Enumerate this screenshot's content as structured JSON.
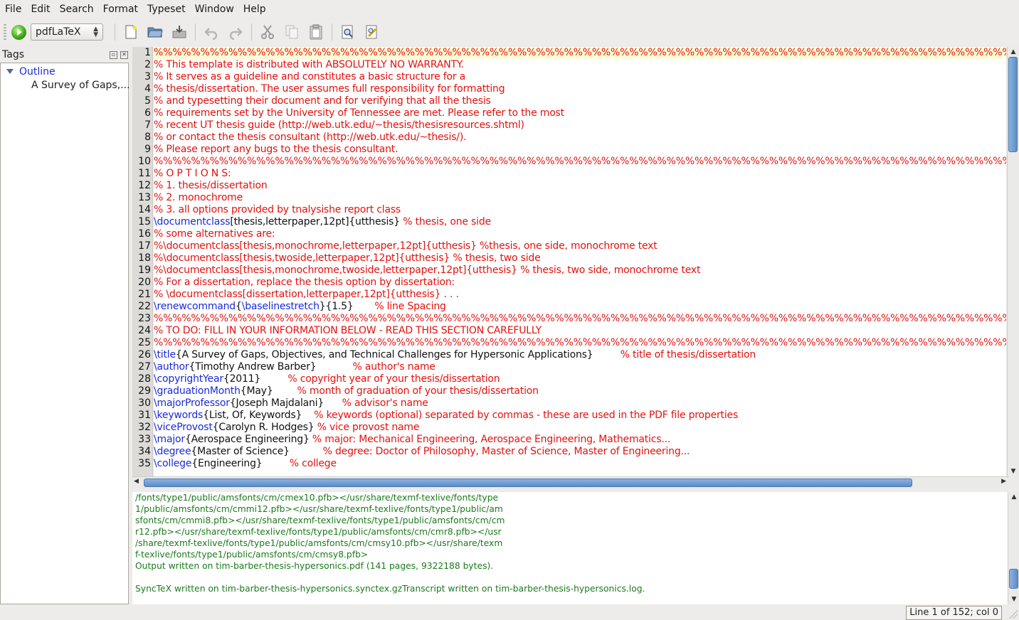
{
  "menu": [
    "File",
    "Edit",
    "Search",
    "Format",
    "Typeset",
    "Window",
    "Help"
  ],
  "toolbar": {
    "engine": "pdfLaTeX",
    "icons": [
      "run-icon",
      "new-file-icon",
      "open-file-icon",
      "save-icon",
      "undo-icon",
      "redo-icon",
      "cut-icon",
      "copy-icon",
      "paste-icon",
      "find-icon",
      "replace-icon"
    ]
  },
  "sidebar": {
    "title": "Tags",
    "outline_label": "Outline",
    "outline_items": [
      "A Survey of Gaps,..."
    ]
  },
  "editor": {
    "lines": [
      {
        "n": "1",
        "parts": [
          {
            "t": "c",
            "s": "%%%%%%%%%%%%%%%%%%%%%%%%%%%%%%%%%%%%%%%%%%%%%%%%%%%%%%%%%%%%%%%%%%%%%%%%%%%%%%%%%%%%%%%%%%%%%%%%%%%%%%%%%%%%%%%%%%%%%%%%%%%%%%%%%%%%%%%%%%%%%%%%%%%%%%%%%%%%%%%%%%%%%%%%%%%%"
          }
        ]
      },
      {
        "n": "2",
        "parts": [
          {
            "t": "c",
            "s": "% This template is distributed with ABSOLUTELY NO WARRANTY."
          }
        ]
      },
      {
        "n": "3",
        "parts": [
          {
            "t": "c",
            "s": "% It serves as a guideline and constitutes a basic structure for a"
          }
        ]
      },
      {
        "n": "4",
        "parts": [
          {
            "t": "c",
            "s": "% thesis/dissertation. The user assumes full responsibility for formatting"
          }
        ]
      },
      {
        "n": "5",
        "parts": [
          {
            "t": "c",
            "s": "% and typesetting their document and for verifying that all the thesis"
          }
        ]
      },
      {
        "n": "6",
        "parts": [
          {
            "t": "c",
            "s": "% requirements set by the University of Tennessee are met. Please refer to the most"
          }
        ]
      },
      {
        "n": "7",
        "parts": [
          {
            "t": "c",
            "s": "% recent UT thesis guide (http://web.utk.edu/~thesis/thesisresources.shtml)"
          }
        ]
      },
      {
        "n": "8",
        "parts": [
          {
            "t": "c",
            "s": "% or contact the thesis consultant (http://web.utk.edu/~thesis/)."
          }
        ]
      },
      {
        "n": "9",
        "parts": [
          {
            "t": "c",
            "s": "% Please report any bugs to the thesis consultant."
          }
        ]
      },
      {
        "n": "10",
        "parts": [
          {
            "t": "c",
            "s": "%%%%%%%%%%%%%%%%%%%%%%%%%%%%%%%%%%%%%%%%%%%%%%%%%%%%%%%%%%%%%%%%%%%%%%%%%%%%%%%%%%%%%%%%%%%%%%%%%%%%%%%%%%%%%%%%%%%%%%%%%%%%%%%%%%%%%%%%%%%%%%%%%%%%%%%%%%%%%%%%%%%%%%%%%%%%"
          }
        ]
      },
      {
        "n": "11",
        "parts": [
          {
            "t": "c",
            "s": "% O P T I O N S:"
          }
        ]
      },
      {
        "n": "12",
        "parts": [
          {
            "t": "c",
            "s": "% 1. thesis/dissertation"
          }
        ]
      },
      {
        "n": "13",
        "parts": [
          {
            "t": "c",
            "s": "% 2. monochrome"
          }
        ]
      },
      {
        "n": "14",
        "parts": [
          {
            "t": "c",
            "s": "% 3. all options provided by tnalysishe report class"
          }
        ]
      },
      {
        "n": "15",
        "parts": [
          {
            "t": "k",
            "s": "\\documentclass"
          },
          {
            "t": "p",
            "s": "[thesis,letterpaper,12pt]{utthesis} "
          },
          {
            "t": "c",
            "s": "% thesis, one side"
          }
        ]
      },
      {
        "n": "16",
        "parts": [
          {
            "t": "c",
            "s": "% some alternatives are:"
          }
        ]
      },
      {
        "n": "17",
        "parts": [
          {
            "t": "c",
            "s": "%\\documentclass[thesis,monochrome,letterpaper,12pt]{utthesis} %thesis, one side, monochrome text"
          }
        ]
      },
      {
        "n": "18",
        "parts": [
          {
            "t": "c",
            "s": "%\\documentclass[thesis,twoside,letterpaper,12pt]{utthesis} % thesis, two side"
          }
        ]
      },
      {
        "n": "19",
        "parts": [
          {
            "t": "c",
            "s": "%\\documentclass[thesis,monochrome,twoside,letterpaper,12pt]{utthesis} % thesis, two side, monochrome text"
          }
        ]
      },
      {
        "n": "20",
        "parts": [
          {
            "t": "c",
            "s": "% For a dissertation, replace the thesis option by dissertation:"
          }
        ]
      },
      {
        "n": "21",
        "parts": [
          {
            "t": "c",
            "s": "% \\documentclass[dissertation,letterpaper,12pt]{utthesis} . . ."
          }
        ]
      },
      {
        "n": "22",
        "parts": [
          {
            "t": "k",
            "s": "\\renewcommand"
          },
          {
            "t": "p",
            "s": "{"
          },
          {
            "t": "k",
            "s": "\\baselinestretch"
          },
          {
            "t": "p",
            "s": "}{1.5}       "
          },
          {
            "t": "c",
            "s": "% line Spacing"
          }
        ]
      },
      {
        "n": "23",
        "parts": [
          {
            "t": "c",
            "s": "%%%%%%%%%%%%%%%%%%%%%%%%%%%%%%%%%%%%%%%%%%%%%%%%%%%%%%%%%%%%%%%%%%%%%%%%%%%%%%%%%%%%%%%%%%%%%%%%%%%%%%%%%%%%%%%%%%%%%%%%%%%%%%%%%%%%%%%%%%%%%%%%%%%%%%%%%%%%%%%%%%%%%%%%%%%%"
          }
        ]
      },
      {
        "n": "24",
        "parts": [
          {
            "t": "c",
            "s": "% TO DO: FILL IN YOUR INFORMATION BELOW - READ THIS SECTION CAREFULLY"
          }
        ]
      },
      {
        "n": "25",
        "parts": [
          {
            "t": "c",
            "s": "%%%%%%%%%%%%%%%%%%%%%%%%%%%%%%%%%%%%%%%%%%%%%%%%%%%%%%%%%%%%%%%%%%%%%%%%%%%%%%%%%%%%%%%%%%%%%%%%%%%%%%%%%%%%%%%%%%%%%%%%%%%%%%%%%%%%%%%%%%%%%%%%%%%%%%%%%%%%%%%%%%%%%%%%%%%%"
          }
        ]
      },
      {
        "n": "26",
        "parts": [
          {
            "t": "k",
            "s": "\\title"
          },
          {
            "t": "p",
            "s": "{A Survey of Gaps, Objectives, and Technical Challenges for Hypersonic Applications}         "
          },
          {
            "t": "c",
            "s": "% title of thesis/dissertation"
          }
        ]
      },
      {
        "n": "27",
        "parts": [
          {
            "t": "k",
            "s": "\\author"
          },
          {
            "t": "p",
            "s": "{Timothy Andrew Barber}            "
          },
          {
            "t": "c",
            "s": "% author's name"
          }
        ]
      },
      {
        "n": "28",
        "parts": [
          {
            "t": "k",
            "s": "\\copyrightYear"
          },
          {
            "t": "p",
            "s": "{2011}         "
          },
          {
            "t": "c",
            "s": "% copyright year of your thesis/dissertation"
          }
        ]
      },
      {
        "n": "29",
        "parts": [
          {
            "t": "k",
            "s": "\\graduationMonth"
          },
          {
            "t": "p",
            "s": "{May}        "
          },
          {
            "t": "c",
            "s": "% month of graduation of your thesis/dissertation"
          }
        ]
      },
      {
        "n": "30",
        "parts": [
          {
            "t": "k",
            "s": "\\majorProfessor"
          },
          {
            "t": "p",
            "s": "{Joseph Majdalani}      "
          },
          {
            "t": "c",
            "s": "% advisor's name"
          }
        ]
      },
      {
        "n": "31",
        "parts": [
          {
            "t": "k",
            "s": "\\keywords"
          },
          {
            "t": "p",
            "s": "{List, Of, Keywords}    "
          },
          {
            "t": "c",
            "s": "% keywords (optional) separated by commas - these are used in the PDF file properties"
          }
        ]
      },
      {
        "n": "32",
        "parts": [
          {
            "t": "k",
            "s": "\\viceProvost"
          },
          {
            "t": "p",
            "s": "{Carolyn R. Hodges} "
          },
          {
            "t": "c",
            "s": "% vice provost name"
          }
        ]
      },
      {
        "n": "33",
        "parts": [
          {
            "t": "k",
            "s": "\\major"
          },
          {
            "t": "p",
            "s": "{Aerospace Engineering} "
          },
          {
            "t": "c",
            "s": "% major: Mechanical Engineering, Aerospace Engineering, Mathematics..."
          }
        ]
      },
      {
        "n": "34",
        "parts": [
          {
            "t": "k",
            "s": "\\degree"
          },
          {
            "t": "p",
            "s": "{Master of Science}           "
          },
          {
            "t": "c",
            "s": "% degree: Doctor of Philosophy, Master of Science, Master of Engineering..."
          }
        ]
      },
      {
        "n": "35",
        "parts": [
          {
            "t": "k",
            "s": "\\college"
          },
          {
            "t": "p",
            "s": "{Engineering}         "
          },
          {
            "t": "c",
            "s": "% college"
          }
        ]
      }
    ]
  },
  "log": {
    "lines": [
      "/fonts/type1/public/amsfonts/cm/cmex10.pfb></usr/share/texmf-texlive/fonts/type",
      "1/public/amsfonts/cm/cmmi12.pfb></usr/share/texmf-texlive/fonts/type1/public/am",
      "sfonts/cm/cmmi8.pfb></usr/share/texmf-texlive/fonts/type1/public/amsfonts/cm/cm",
      "r12.pfb></usr/share/texmf-texlive/fonts/type1/public/amsfonts/cm/cmr8.pfb></usr",
      "/share/texmf-texlive/fonts/type1/public/amsfonts/cm/cmsy10.pfb></usr/share/texm",
      "f-texlive/fonts/type1/public/amsfonts/cm/cmsy8.pfb>",
      "Output written on tim-barber-thesis-hypersonics.pdf (141 pages, 9322188 bytes).",
      "",
      "SyncTeX written on tim-barber-thesis-hypersonics.synctex.gzTranscript written on tim-barber-thesis-hypersonics.log."
    ]
  },
  "status": {
    "position": "Line 1 of 152; col 0"
  },
  "colors": {
    "comment": "#e2120e",
    "keyword": "#1a2ad8",
    "log_text": "#1c7a1c",
    "current_line": "#fffbd6",
    "scrollbar": "#5c8dc9"
  }
}
